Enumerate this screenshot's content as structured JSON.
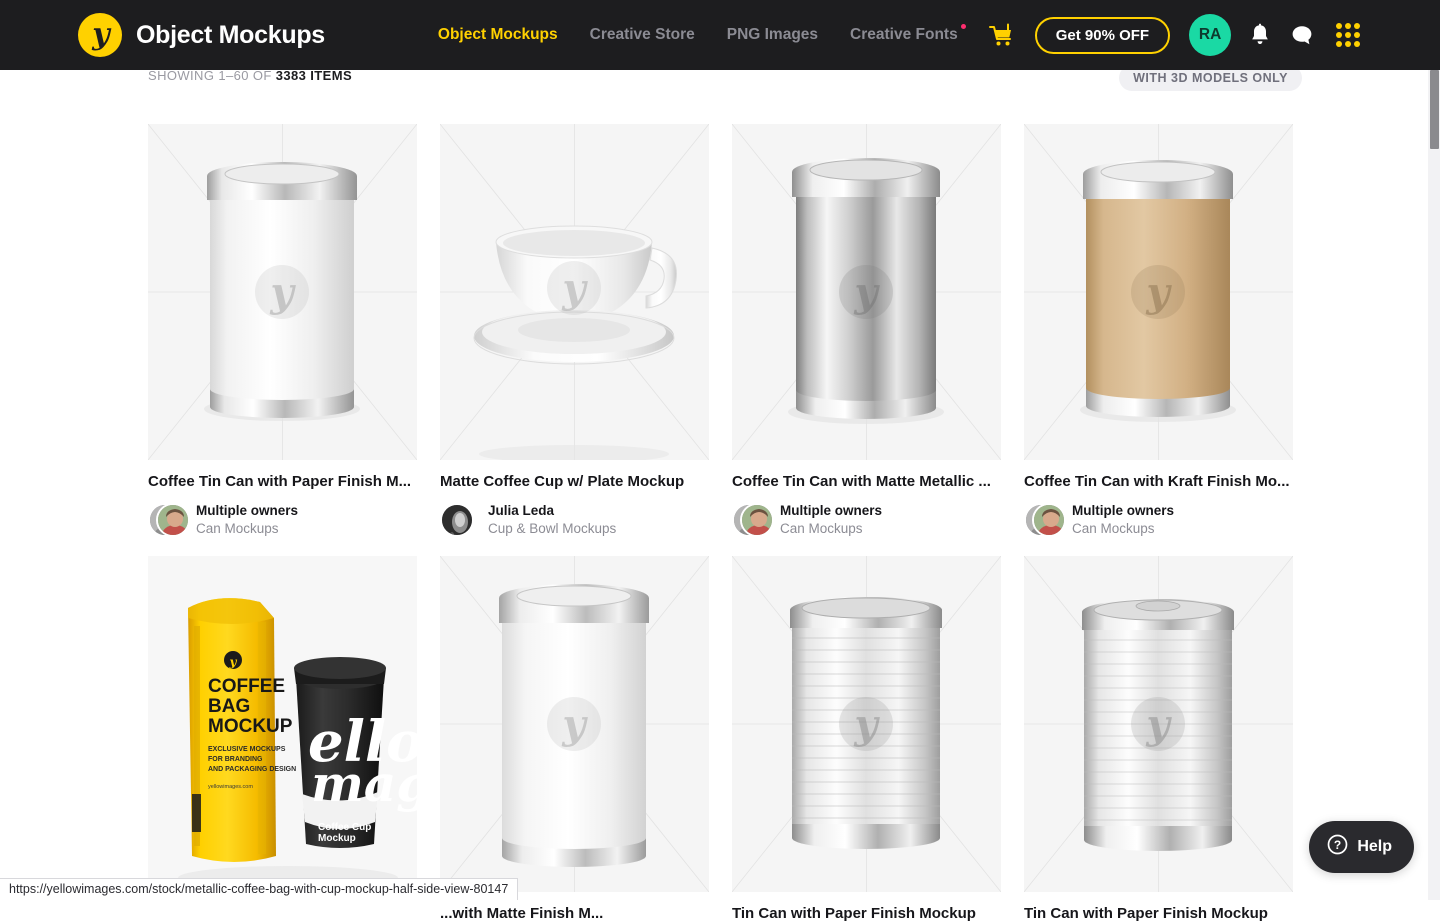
{
  "header": {
    "logo_text": "Object Mockups",
    "logo_icon": "yellowimages-y-logo",
    "nav": [
      {
        "label": "Object Mockups",
        "active": true,
        "dot": false
      },
      {
        "label": "Creative Store",
        "active": false,
        "dot": false
      },
      {
        "label": "PNG Images",
        "active": false,
        "dot": false
      },
      {
        "label": "Creative Fonts",
        "active": false,
        "dot": true
      }
    ],
    "cart_icon": "shopping-cart-icon",
    "promo_label": "Get 90% OFF",
    "avatar_initials": "RA",
    "bell_icon": "notification-bell-icon",
    "chat_icon": "chat-bubble-icon",
    "apps_icon": "apps-grid-icon",
    "accent_yellow": "#ffd100",
    "bar_background": "#1d1d1f",
    "avatar_color": "#1ad9a4",
    "dot_color": "#ff2d6f"
  },
  "toolbar": {
    "showing_prefix": "SHOWING 1–60 OF ",
    "showing_count": "3383 ITEMS",
    "filter_chip": "WITH 3D MODELS ONLY"
  },
  "grid": {
    "cards": [
      {
        "title": "Coffee Tin Can with Paper Finish M...",
        "owner": "Multiple owners",
        "category": "Can Mockups",
        "avatar_type": "multiple",
        "art": "tin-can-paper-white"
      },
      {
        "title": "Matte Coffee Cup w/ Plate Mockup",
        "owner": "Julia Leda",
        "category": "Cup & Bowl Mockups",
        "avatar_type": "single",
        "art": "coffee-cup-plate"
      },
      {
        "title": "Coffee Tin Can with Matte Metallic ...",
        "owner": "Multiple owners",
        "category": "Can Mockups",
        "avatar_type": "multiple",
        "art": "tin-can-metallic"
      },
      {
        "title": "Coffee Tin Can with Kraft Finish Mo...",
        "owner": "Multiple owners",
        "category": "Can Mockups",
        "avatar_type": "multiple",
        "art": "tin-can-kraft"
      },
      {
        "title": "",
        "owner": "",
        "category": "",
        "avatar_type": "none",
        "art": "coffee-bag-with-cup",
        "bag_text_1": "COFFEE",
        "bag_text_2": "BAG",
        "bag_text_3": "MOCKUP",
        "bag_text_4": "EXCLUSIVE MOCKUPS",
        "bag_text_5": "FOR BRANDING",
        "bag_text_6": "AND PACKAGING DESIGN",
        "bag_text_7": "yellowimages.com",
        "cup_text_1": "ello",
        "cup_text_2": "mag",
        "cup_text_3": "Coffee Cup",
        "cup_text_4": "Mockup"
      },
      {
        "title": "...with Matte Finish M...",
        "owner": "",
        "category": "",
        "avatar_type": "none",
        "art": "tin-can-matte-white"
      },
      {
        "title": "Tin Can with Paper Finish Mockup",
        "owner": "",
        "category": "",
        "avatar_type": "none",
        "art": "tin-can-ribbed-a"
      },
      {
        "title": "Tin Can with Paper Finish Mockup",
        "owner": "",
        "category": "",
        "avatar_type": "none",
        "art": "tin-can-ribbed-b"
      }
    ]
  },
  "status_bar": {
    "url": "https://yellowimages.com/stock/metallic-coffee-bag-with-cup-mockup-half-side-view-80147"
  },
  "help_widget": {
    "label": "Help",
    "icon": "question-circle-icon"
  }
}
